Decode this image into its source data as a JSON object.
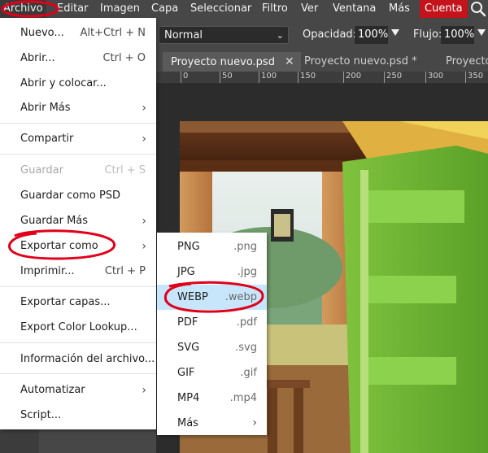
{
  "menubar": {
    "items": [
      "Archivo",
      "Editar",
      "Imagen",
      "Capa",
      "Seleccionar",
      "Filtro",
      "Ver",
      "Ventana",
      "Más"
    ],
    "account": "Cuenta",
    "search_icon": "search-icon"
  },
  "toolbar": {
    "blend_mode": "Normal",
    "opacity_label": "Opacidad:",
    "opacity_value": "100%",
    "flow_label": "Flujo:",
    "flow_value": "100%"
  },
  "tabs": [
    {
      "label": "Proyecto nuevo.psd",
      "close": "✕"
    },
    {
      "label": "Proyecto nuevo.psd *"
    },
    {
      "label": "Proyecto"
    }
  ],
  "ruler": {
    "ticks": [
      "0",
      "50",
      "100",
      "150",
      "200",
      "250",
      "300",
      "350"
    ]
  },
  "file_menu": {
    "items": [
      {
        "label": "Nuevo...",
        "shortcut": "Alt+Ctrl + N"
      },
      {
        "label": "Abrir...",
        "shortcut": "Ctrl + O"
      },
      {
        "label": "Abrir y colocar..."
      },
      {
        "label": "Abrir Más",
        "arrow": "›"
      },
      {
        "label": "Compartir",
        "arrow": "›"
      },
      {
        "label": "Guardar",
        "shortcut": "Ctrl + S"
      },
      {
        "label": "Guardar como PSD"
      },
      {
        "label": "Guardar Más",
        "arrow": "›"
      },
      {
        "label": "Exportar como",
        "arrow": "›"
      },
      {
        "label": "Imprimir...",
        "shortcut": "Ctrl + P"
      },
      {
        "label": "Exportar capas..."
      },
      {
        "label": "Export Color Lookup..."
      },
      {
        "label": "Información del archivo..."
      },
      {
        "label": "Automatizar",
        "arrow": "›"
      },
      {
        "label": "Script..."
      }
    ]
  },
  "export_submenu": {
    "items": [
      {
        "label": "PNG",
        "ext": ".png"
      },
      {
        "label": "JPG",
        "ext": ".jpg"
      },
      {
        "label": "WEBP",
        "ext": ".webp"
      },
      {
        "label": "PDF",
        "ext": ".pdf"
      },
      {
        "label": "SVG",
        "ext": ".svg"
      },
      {
        "label": "GIF",
        "ext": ".gif"
      },
      {
        "label": "MP4",
        "ext": ".mp4"
      },
      {
        "label": "Más",
        "arrow": "›"
      }
    ]
  },
  "colors": {
    "accent_red": "#c4131b",
    "highlight": "#c7e6fb",
    "annotation": "#e0001a"
  }
}
